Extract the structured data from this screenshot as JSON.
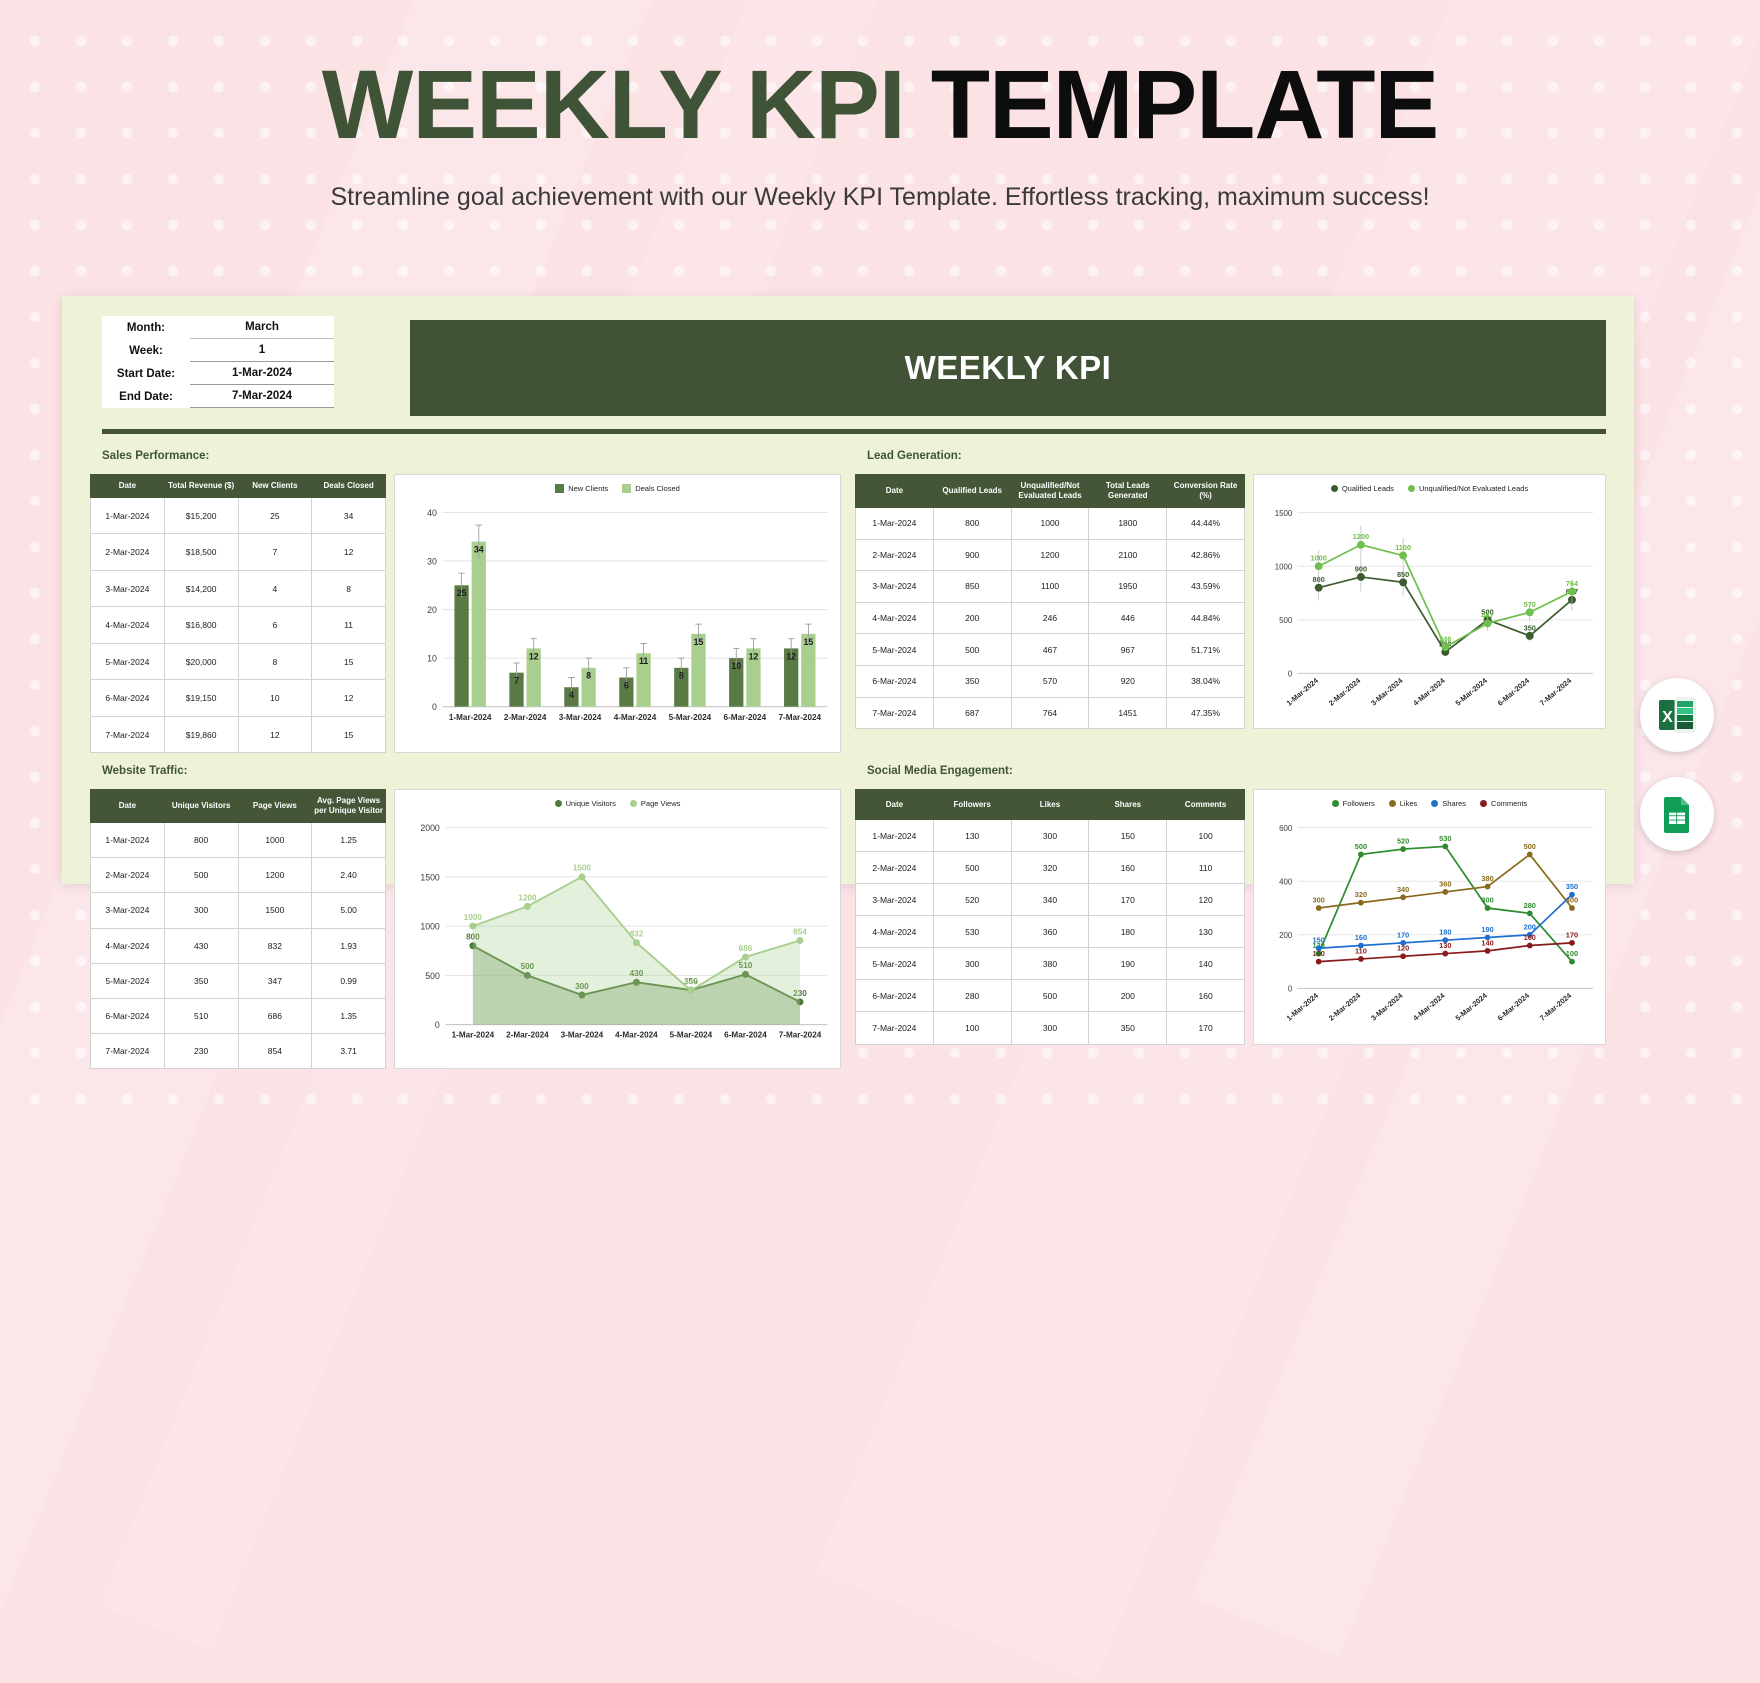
{
  "header": {
    "title_green": "WEEKLY KPI",
    "title_black": "TEMPLATE",
    "subtitle": "Streamline goal achievement with our Weekly KPI Template. Effortless tracking, maximum success!"
  },
  "colors": {
    "dark_green": "#415236",
    "mid_green": "#5a7a45",
    "light_green": "#a9cf8f",
    "accent_green": "#3f8f3f",
    "brown": "#8a6a1e",
    "blue": "#1f6fd0",
    "dark_red": "#8b1a1a",
    "sheet_bg": "#eef3d7",
    "page_bg": "#fbe2e5"
  },
  "meta": {
    "rows": [
      {
        "label": "Month:",
        "value": "March"
      },
      {
        "label": "Week:",
        "value": "1"
      },
      {
        "label": "Start Date:",
        "value": "1-Mar-2024"
      },
      {
        "label": "End Date:",
        "value": "7-Mar-2024"
      }
    ]
  },
  "banner": {
    "label": "WEEKLY KPI"
  },
  "sections": {
    "sales": {
      "heading": "Sales Performance:",
      "columns": [
        "Date",
        "Total Revenue ($)",
        "New Clients",
        "Deals Closed"
      ],
      "rows": [
        [
          "1-Mar-2024",
          "$15,200",
          "25",
          "34"
        ],
        [
          "2-Mar-2024",
          "$18,500",
          "7",
          "12"
        ],
        [
          "3-Mar-2024",
          "$14,200",
          "4",
          "8"
        ],
        [
          "4-Mar-2024",
          "$16,800",
          "6",
          "11"
        ],
        [
          "5-Mar-2024",
          "$20,000",
          "8",
          "15"
        ],
        [
          "6-Mar-2024",
          "$19,150",
          "10",
          "12"
        ],
        [
          "7-Mar-2024",
          "$19,860",
          "12",
          "15"
        ]
      ]
    },
    "lead": {
      "heading": "Lead Generation:",
      "columns": [
        "Date",
        "Qualified Leads",
        "Unqualified/Not Evaluated Leads",
        "Total Leads Generated",
        "Conversion Rate (%)"
      ],
      "rows": [
        [
          "1-Mar-2024",
          "800",
          "1000",
          "1800",
          "44.44%"
        ],
        [
          "2-Mar-2024",
          "900",
          "1200",
          "2100",
          "42.86%"
        ],
        [
          "3-Mar-2024",
          "850",
          "1100",
          "1950",
          "43.59%"
        ],
        [
          "4-Mar-2024",
          "200",
          "246",
          "446",
          "44.84%"
        ],
        [
          "5-Mar-2024",
          "500",
          "467",
          "967",
          "51.71%"
        ],
        [
          "6-Mar-2024",
          "350",
          "570",
          "920",
          "38.04%"
        ],
        [
          "7-Mar-2024",
          "687",
          "764",
          "1451",
          "47.35%"
        ]
      ]
    },
    "traffic": {
      "heading": "Website Traffic:",
      "columns": [
        "Date",
        "Unique Visitors",
        "Page Views",
        "Avg. Page Views per Unique Visitor"
      ],
      "rows": [
        [
          "1-Mar-2024",
          "800",
          "1000",
          "1.25"
        ],
        [
          "2-Mar-2024",
          "500",
          "1200",
          "2.40"
        ],
        [
          "3-Mar-2024",
          "300",
          "1500",
          "5.00"
        ],
        [
          "4-Mar-2024",
          "430",
          "832",
          "1.93"
        ],
        [
          "5-Mar-2024",
          "350",
          "347",
          "0.99"
        ],
        [
          "6-Mar-2024",
          "510",
          "686",
          "1.35"
        ],
        [
          "7-Mar-2024",
          "230",
          "854",
          "3.71"
        ]
      ]
    },
    "social": {
      "heading": "Social Media Engagement:",
      "columns": [
        "Date",
        "Followers",
        "Likes",
        "Shares",
        "Comments"
      ],
      "rows": [
        [
          "1-Mar-2024",
          "130",
          "300",
          "150",
          "100"
        ],
        [
          "2-Mar-2024",
          "500",
          "320",
          "160",
          "110"
        ],
        [
          "3-Mar-2024",
          "520",
          "340",
          "170",
          "120"
        ],
        [
          "4-Mar-2024",
          "530",
          "360",
          "180",
          "130"
        ],
        [
          "5-Mar-2024",
          "300",
          "380",
          "190",
          "140"
        ],
        [
          "6-Mar-2024",
          "280",
          "500",
          "200",
          "160"
        ],
        [
          "7-Mar-2024",
          "100",
          "300",
          "350",
          "170"
        ]
      ]
    }
  },
  "chart_data": [
    {
      "id": "sales-chart",
      "type": "bar",
      "title": "",
      "categories": [
        "1-Mar-2024",
        "2-Mar-2024",
        "3-Mar-2024",
        "4-Mar-2024",
        "5-Mar-2024",
        "6-Mar-2024",
        "7-Mar-2024"
      ],
      "series": [
        {
          "name": "New Clients",
          "color": "#5a7a45",
          "values": [
            25,
            7,
            4,
            6,
            8,
            10,
            12
          ]
        },
        {
          "name": "Deals Closed",
          "color": "#a9cf8f",
          "values": [
            34,
            12,
            8,
            11,
            15,
            12,
            15
          ]
        }
      ],
      "ylim": [
        0,
        42
      ],
      "yticks": [
        0,
        10,
        20,
        30,
        40
      ],
      "xlabel": "",
      "ylabel": "",
      "grid": true,
      "legend": "top",
      "error_bars": true
    },
    {
      "id": "lead-chart",
      "type": "line",
      "title": "",
      "categories": [
        "1-Mar-2024",
        "2-Mar-2024",
        "3-Mar-2024",
        "4-Mar-2024",
        "5-Mar-2024",
        "6-Mar-2024",
        "7-Mar-2024"
      ],
      "series": [
        {
          "name": "Qualified Leads",
          "color": "#3c5c2e",
          "values": [
            800,
            900,
            850,
            200,
            500,
            350,
            687
          ]
        },
        {
          "name": "Unqualified/Not Evaluated Leads",
          "color": "#6fbf4c",
          "values": [
            1000,
            1200,
            1100,
            246,
            467,
            570,
            764
          ]
        }
      ],
      "ylim": [
        0,
        1600
      ],
      "yticks": [
        0,
        500,
        1000,
        1500
      ],
      "xlabel": "",
      "ylabel": "",
      "grid": true,
      "legend": "top",
      "error_bars": true
    },
    {
      "id": "traffic-chart",
      "type": "area",
      "title": "",
      "categories": [
        "1-Mar-2024",
        "2-Mar-2024",
        "3-Mar-2024",
        "4-Mar-2024",
        "5-Mar-2024",
        "6-Mar-2024",
        "7-Mar-2024"
      ],
      "series": [
        {
          "name": "Unique Visitors",
          "color": "#4f7a3a",
          "values": [
            800,
            500,
            300,
            430,
            350,
            510,
            230
          ]
        },
        {
          "name": "Page Views",
          "color": "#a9cf8f",
          "values": [
            1000,
            1200,
            1500,
            832,
            347,
            686,
            854
          ]
        }
      ],
      "ylim": [
        0,
        2100
      ],
      "yticks": [
        0,
        500,
        1000,
        1500,
        2000
      ],
      "xlabel": "",
      "ylabel": "",
      "grid": true,
      "legend": "top"
    },
    {
      "id": "social-chart",
      "type": "line",
      "title": "",
      "categories": [
        "1-Mar-2024",
        "2-Mar-2024",
        "3-Mar-2024",
        "4-Mar-2024",
        "5-Mar-2024",
        "6-Mar-2024",
        "7-Mar-2024"
      ],
      "series": [
        {
          "name": "Followers",
          "color": "#2e8b2e",
          "values": [
            130,
            500,
            520,
            530,
            300,
            280,
            100
          ]
        },
        {
          "name": "Likes",
          "color": "#8a6a1e",
          "values": [
            300,
            320,
            340,
            360,
            380,
            500,
            300
          ]
        },
        {
          "name": "Shares",
          "color": "#1f6fd0",
          "values": [
            150,
            160,
            170,
            180,
            190,
            200,
            350
          ]
        },
        {
          "name": "Comments",
          "color": "#8b1a1a",
          "values": [
            100,
            110,
            120,
            130,
            140,
            160,
            170
          ]
        }
      ],
      "ylim": [
        0,
        640
      ],
      "yticks": [
        0,
        200,
        400,
        600
      ],
      "xlabel": "",
      "ylabel": "",
      "grid": true,
      "legend": "top"
    }
  ],
  "badges": {
    "excel": "excel-icon",
    "sheets": "google-sheets-icon"
  }
}
